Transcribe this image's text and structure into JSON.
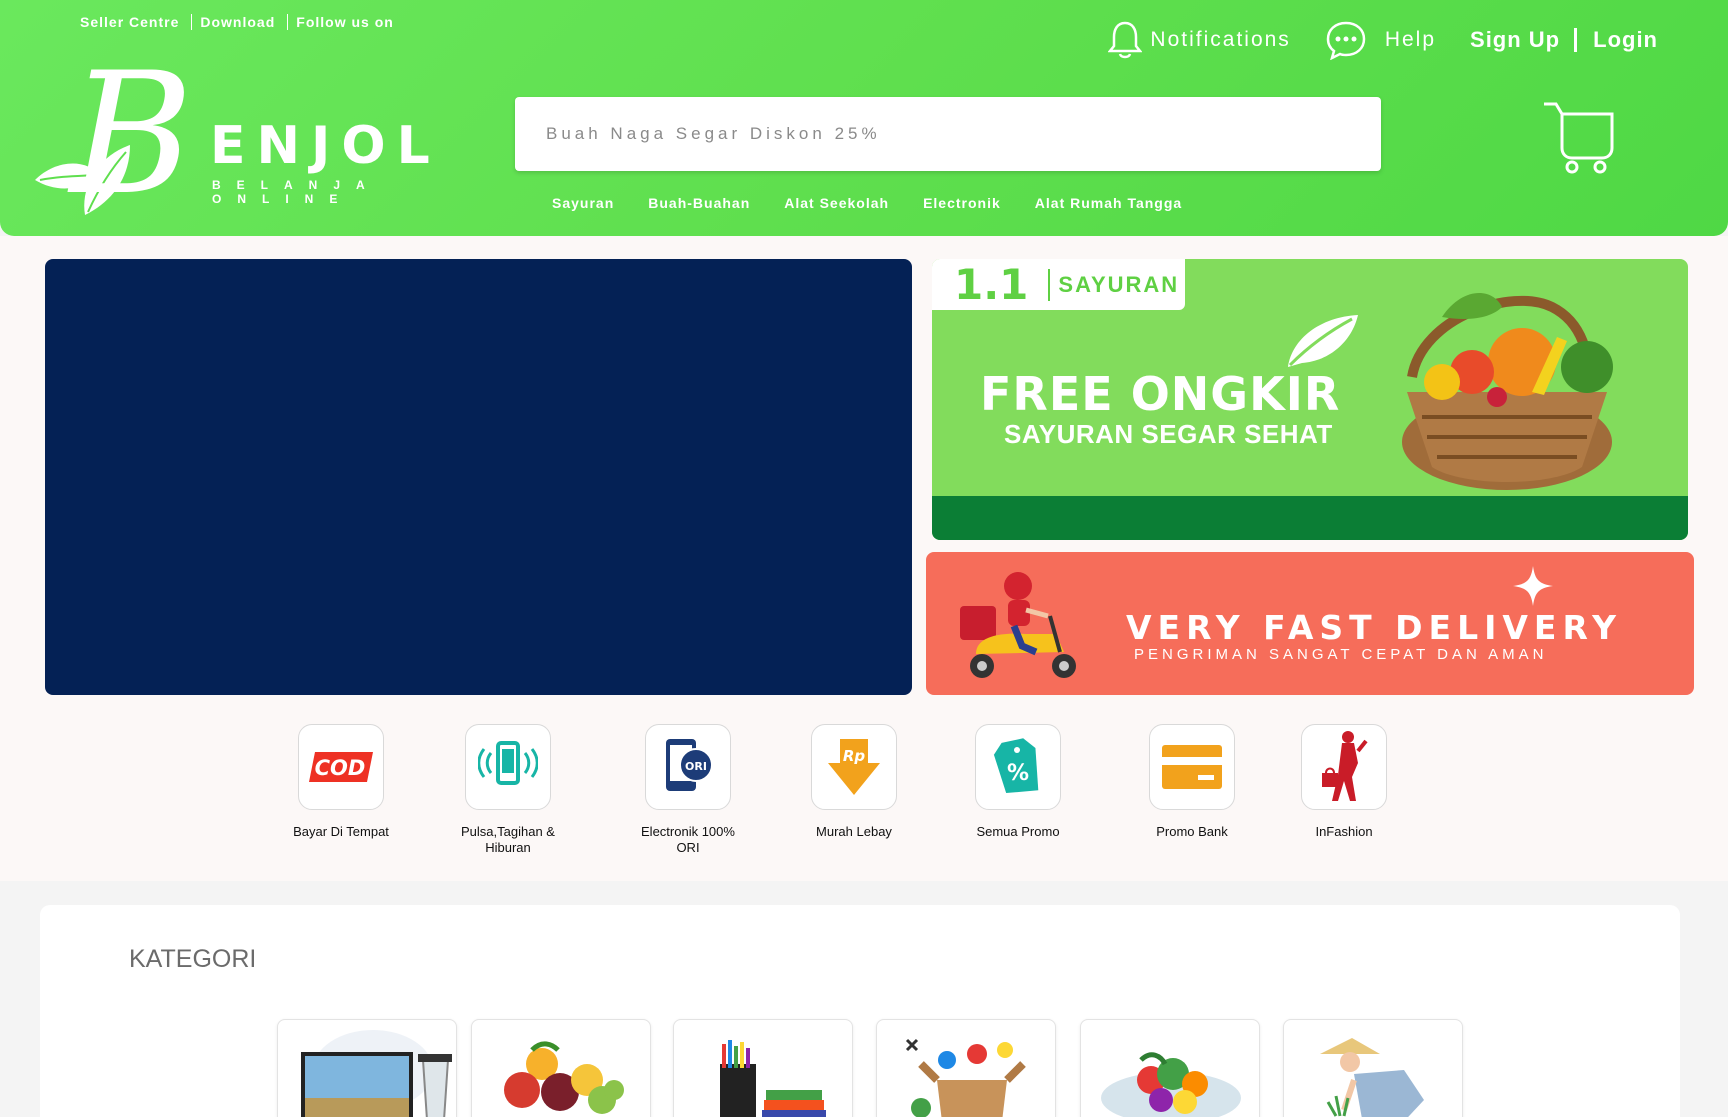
{
  "top_links": {
    "seller": "Seller Centre",
    "download": "Download",
    "follow": "Follow us on"
  },
  "logo": {
    "letter": "B",
    "rest": "ENJOL",
    "tagline": "BELANJA ONLINE"
  },
  "nav": {
    "notifications": "Notifications",
    "help": "Help",
    "signup": "Sign Up",
    "login": "Login"
  },
  "search": {
    "placeholder": "Buah Naga Segar Diskon 25%"
  },
  "categories_nav": [
    "Sayuran",
    "Buah-Buahan",
    "Alat Seekolah",
    "Electronik",
    "Alat Rumah Tangga"
  ],
  "banner_green": {
    "badge_number": "1.1",
    "badge_text": "SAYURAN",
    "title": "FREE ONGKIR",
    "subtitle": "SAYURAN SEGAR SEHAT"
  },
  "banner_red": {
    "title": "VERY FAST DELIVERY",
    "subtitle": "PENGRIMAN SANGAT CEPAT DAN AMAN"
  },
  "quick_icons": [
    {
      "label": "Bayar Di Tempat",
      "icon": "cod-icon"
    },
    {
      "label": "Pulsa,Tagihan & Hiburan",
      "icon": "phone-signal-icon"
    },
    {
      "label": "Electronik 100% ORI",
      "icon": "ori-phone-icon"
    },
    {
      "label": "Murah Lebay",
      "icon": "rupiah-arrow-icon"
    },
    {
      "label": "Semua Promo",
      "icon": "percent-tag-icon"
    },
    {
      "label": "Promo Bank",
      "icon": "bank-card-icon"
    },
    {
      "label": "InFashion",
      "icon": "fashion-icon"
    }
  ],
  "kategori": {
    "title": "KATEGORI"
  },
  "colors": {
    "header_green": "#5fdf4e",
    "hero_navy": "#042155",
    "banner_green": "#82dc5c",
    "banner_strip": "#0b7e35",
    "banner_red": "#f66d5a"
  }
}
